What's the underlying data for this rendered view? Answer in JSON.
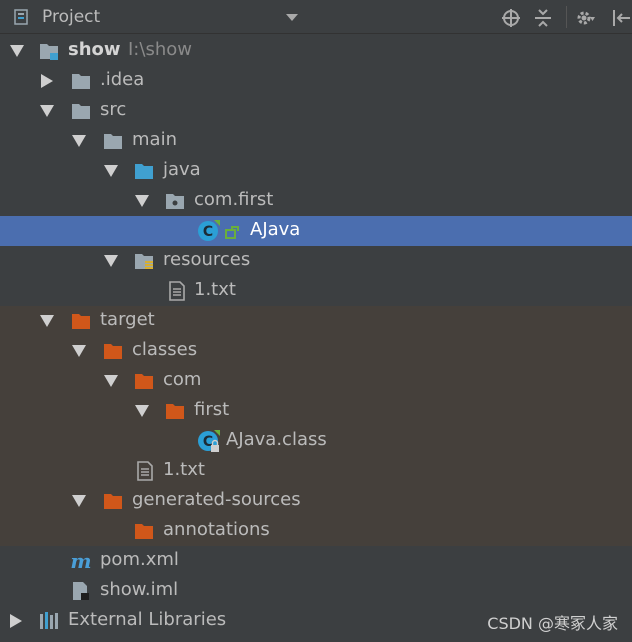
{
  "header": {
    "title": "Project",
    "icons": [
      "project-view-icon",
      "dropdown-arrow-icon",
      "locate-icon",
      "collapse-all-icon",
      "settings-icon",
      "hide-panel-icon"
    ]
  },
  "tree": {
    "show": {
      "label": "show",
      "path": "I:\\show"
    },
    "idea": {
      "label": ".idea"
    },
    "src": {
      "label": "src"
    },
    "main": {
      "label": "main"
    },
    "java": {
      "label": "java"
    },
    "com_first": {
      "label": "com.first"
    },
    "ajava": {
      "label": "AJava"
    },
    "resources": {
      "label": "resources"
    },
    "txt1": {
      "label": "1.txt"
    },
    "target": {
      "label": "target"
    },
    "classes": {
      "label": "classes"
    },
    "com": {
      "label": "com"
    },
    "first": {
      "label": "first"
    },
    "ajava_class": {
      "label": "AJava.class"
    },
    "txt2": {
      "label": "1.txt"
    },
    "generated_sources": {
      "label": "generated-sources"
    },
    "annotations": {
      "label": "annotations"
    },
    "pom": {
      "label": "pom.xml"
    },
    "show_iml": {
      "label": "show.iml"
    },
    "external_libraries": {
      "label": "External Libraries"
    }
  },
  "colors": {
    "background": "#3c3f41",
    "selected": "#4b6eaf",
    "excluded": "#45403b",
    "folder_gray": "#9aa7b0",
    "folder_source": "#40a0d0",
    "folder_excluded": "#d0571a"
  },
  "watermark": "CSDN @寒冢人家"
}
